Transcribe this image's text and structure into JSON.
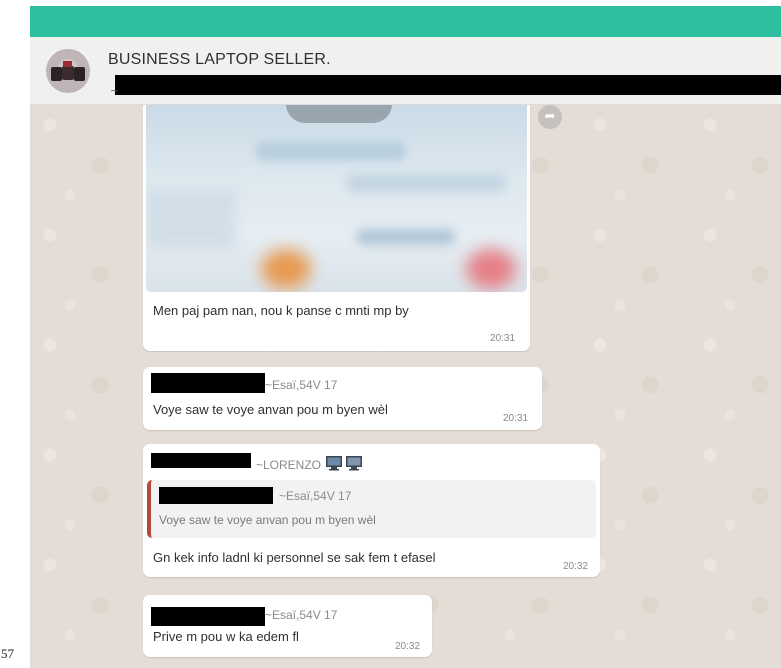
{
  "header": {
    "title": "BUSINESS LAPTOP SELLER.",
    "subtitle_mark": "~"
  },
  "messages": [
    {
      "type": "image",
      "caption": "Men paj pam nan, nou k panse c mnti mp by",
      "time": "20:31"
    },
    {
      "sender": "~Esaï,54V 17",
      "text": "Voye saw te voye anvan pou m byen wèl",
      "time": "20:31"
    },
    {
      "sender": "~LORENZO",
      "quote": {
        "sender": "~Esaï,54V 17",
        "text": "Voye saw te voye anvan pou m byen wèl"
      },
      "text": "Gn kek info ladnl ki personnel se sak fem t efasel",
      "time": "20:32"
    },
    {
      "sender": "~Esaï,54V 17",
      "text": "Prive m pou w ka edem fl",
      "time": "20:32"
    }
  ],
  "side_number": "57",
  "colors": {
    "topbar": "#2dbfa0",
    "chat_bg": "#e5ddd5",
    "quote_bar": "#b54a3a"
  },
  "icons": {
    "forward": "forward-icon",
    "download": "download-pill",
    "sender_badge": "monitor-icon"
  }
}
